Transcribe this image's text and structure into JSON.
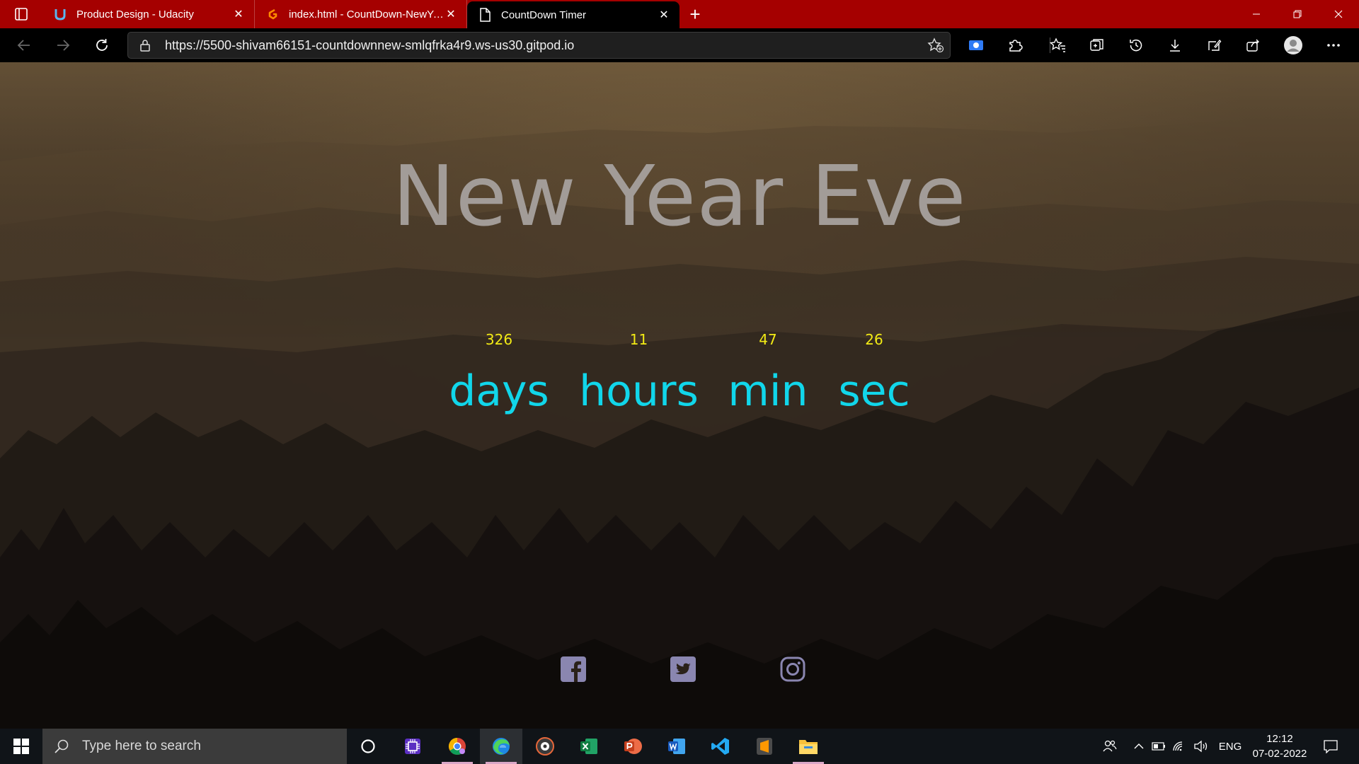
{
  "browser": {
    "tabs": [
      {
        "title": "Product Design - Udacity",
        "icon": "udacity-icon",
        "active": false
      },
      {
        "title": "index.html - CountDown-NewYear",
        "icon": "gitpod-icon",
        "active": false
      },
      {
        "title": "CountDown Timer",
        "icon": "page-icon",
        "active": true
      }
    ],
    "url": "https://5500-shivam66151-countdownnew-smlqfrka4r9.ws-us30.gitpod.io"
  },
  "page": {
    "heading": "New Year Eve",
    "countdown": [
      {
        "value": "326",
        "label": "days"
      },
      {
        "value": "11",
        "label": "hours"
      },
      {
        "value": "47",
        "label": "min"
      },
      {
        "value": "26",
        "label": "sec"
      }
    ],
    "socials": [
      "facebook-icon",
      "twitter-icon",
      "instagram-icon"
    ],
    "colors": {
      "heading": "#a29c98",
      "numbers": "#f2ea15",
      "labels": "#11d6ea",
      "tabbar": "#a50000"
    }
  },
  "taskbar": {
    "search_placeholder": "Type here to search",
    "apps": [
      "cortana-icon",
      "chip-app-icon",
      "chrome-icon",
      "edge-icon",
      "media-app-icon",
      "excel-icon",
      "powerpoint-icon",
      "word-icon",
      "vscode-icon",
      "sublime-icon",
      "file-explorer-icon"
    ],
    "language": "ENG",
    "time": "12:12",
    "date": "07-02-2022"
  }
}
